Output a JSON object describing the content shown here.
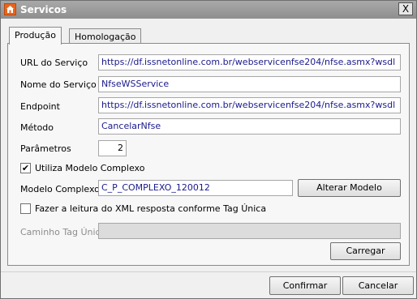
{
  "window": {
    "title": "Servicos",
    "close_label": "X"
  },
  "tabs": [
    {
      "label": "Produção"
    },
    {
      "label": "Homologação"
    }
  ],
  "form": {
    "url_label": "URL do Serviço",
    "url_value": "https://df.issnetonline.com.br/webservicenfse204/nfse.asmx?wsdl",
    "name_label": "Nome do Serviço",
    "name_value": "NfseWSService",
    "endpoint_label": "Endpoint",
    "endpoint_value": "https://df.issnetonline.com.br/webservicenfse204/nfse.asmx?wsdl",
    "method_label": "Método",
    "method_value": "CancelarNfse",
    "params_label": "Parâmetros",
    "params_value": "2",
    "complex_checkbox_label": "Utiliza Modelo Complexo",
    "complex_checked": true,
    "complex_model_label": "Modelo Complexo",
    "complex_model_value": "C_P_COMPLEXO_120012",
    "change_model_button": "Alterar Modelo",
    "tag_checkbox_label": "Fazer a leitura do XML resposta conforme Tag Única",
    "tag_checked": false,
    "tag_path_label": "Caminho Tag Única",
    "tag_path_value": "",
    "load_button": "Carregar"
  },
  "footer": {
    "confirm_button": "Confirmar",
    "cancel_button": "Cancelar"
  },
  "colors": {
    "field_text": "#1a1a8c",
    "titlebar": "#999999",
    "app_icon": "#e9641c"
  }
}
